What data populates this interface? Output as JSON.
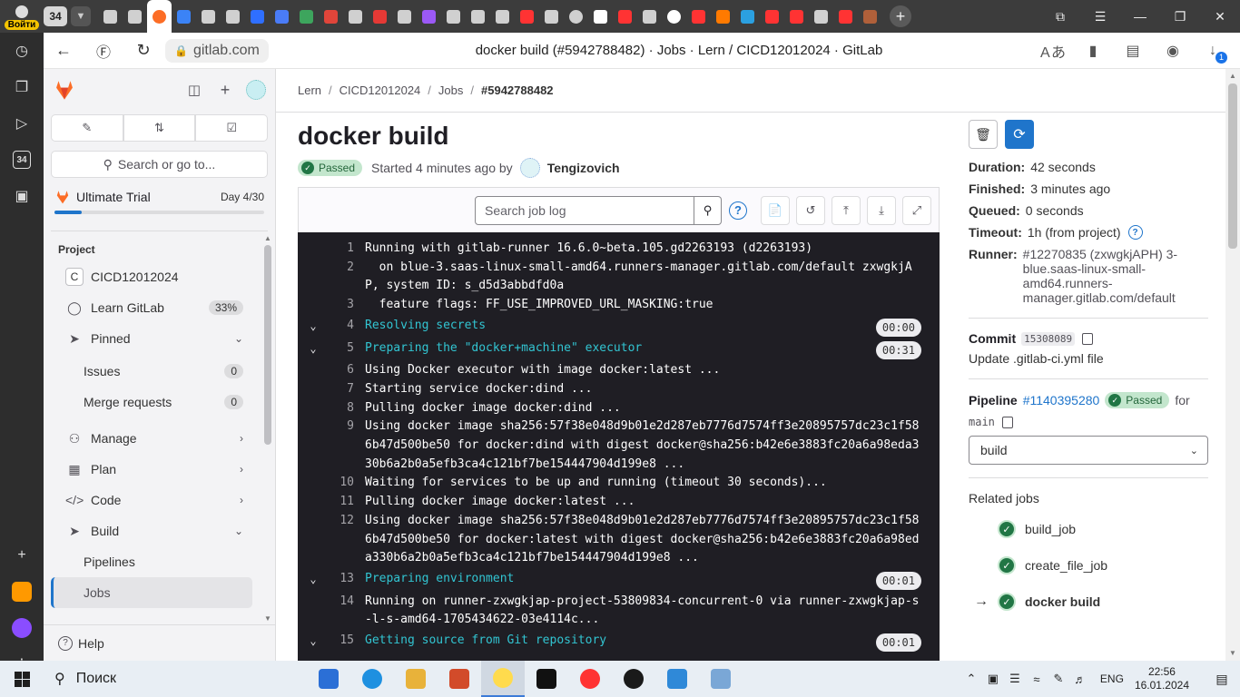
{
  "browser": {
    "login_label": "Войти",
    "tab_count": "34",
    "url": "gitlab.com",
    "page_title": "docker build (#5942788482) · Jobs · Lern / CICD12012024 · GitLab",
    "downloads_badge": "1",
    "sidebar_badge": "34",
    "tab_icon_colors": [
      "#d0d0d0",
      "#d0d0d0",
      "#fc6d26",
      "#3b83f6",
      "#d0d0d0",
      "#d0d0d0",
      "#2f6fff",
      "#4a7cf7",
      "#3da55d",
      "#e0453a",
      "#d0d0d0",
      "#e53935",
      "#d0d0d0",
      "#9b59f6",
      "#d0d0d0",
      "#d0d0d0",
      "#d0d0d0",
      "#f33",
      "#d0d0d0",
      "#d0d0d0",
      "#ffffff",
      "#f33",
      "#d0d0d0",
      "#ffffff",
      "#f33",
      "#ff7a00",
      "#2ba0e0",
      "#f33",
      "#f33",
      "#d0d0d0",
      "#f33",
      "#b0603a"
    ]
  },
  "gitlab_sidebar": {
    "search_label": "Search or go to...",
    "trial": {
      "name": "Ultimate Trial",
      "day": "Day 4/30",
      "progress": 0.13
    },
    "section_title": "Project",
    "items": [
      {
        "label": "CICD12012024",
        "icon": "project-avatar",
        "initial": "C"
      },
      {
        "label": "Learn GitLab",
        "icon": "bulb-icon",
        "count": "33%"
      },
      {
        "label": "Pinned",
        "icon": "pin-icon",
        "chevron": "down"
      },
      {
        "label": "Issues",
        "count": "0",
        "sub": true
      },
      {
        "label": "Merge requests",
        "count": "0",
        "sub": true
      },
      {
        "label": "Manage",
        "icon": "users-icon",
        "chevron": "right"
      },
      {
        "label": "Plan",
        "icon": "calendar-icon",
        "chevron": "right"
      },
      {
        "label": "Code",
        "icon": "code-icon",
        "chevron": "right"
      },
      {
        "label": "Build",
        "icon": "rocket-icon",
        "chevron": "down"
      },
      {
        "label": "Pipelines",
        "sub": true
      },
      {
        "label": "Jobs",
        "sub": true,
        "active": true
      }
    ],
    "help_label": "Help"
  },
  "breadcrumbs": [
    "Lern",
    "CICD12012024",
    "Jobs",
    "#5942788482"
  ],
  "job": {
    "title": "docker build",
    "status": "Passed",
    "started": "Started 4 minutes ago by",
    "author": "Tengizovich"
  },
  "log_toolbar": {
    "search_placeholder": "Search job log"
  },
  "log_lines": [
    {
      "n": "1",
      "text": "Running with gitlab-runner 16.6.0~beta.105.gd2263193 (d2263193)"
    },
    {
      "n": "2",
      "text": "  on blue-3.saas-linux-small-amd64.runners-manager.gitlab.com/default zxwgkjAP, system ID: s_d5d3abbdfd0a"
    },
    {
      "n": "3",
      "text": "  feature flags: FF_USE_IMPROVED_URL_MASKING:true"
    },
    {
      "n": "4",
      "text": "Resolving secrets",
      "section": true,
      "dur": "00:00"
    },
    {
      "n": "5",
      "text": "Preparing the \"docker+machine\" executor",
      "section": true,
      "dur": "00:31"
    },
    {
      "n": "6",
      "text": "Using Docker executor with image docker:latest ..."
    },
    {
      "n": "7",
      "text": "Starting service docker:dind ..."
    },
    {
      "n": "8",
      "text": "Pulling docker image docker:dind ..."
    },
    {
      "n": "9",
      "text": "Using docker image sha256:57f38e048d9b01e2d287eb7776d7574ff3e20895757dc23c1f586b47d500be50 for docker:dind with digest docker@sha256:b42e6e3883fc20a6a98eda330b6a2b0a5efb3ca4c121bf7be154447904d199e8 ..."
    },
    {
      "n": "10",
      "text": "Waiting for services to be up and running (timeout 30 seconds)..."
    },
    {
      "n": "11",
      "text": "Pulling docker image docker:latest ..."
    },
    {
      "n": "12",
      "text": "Using docker image sha256:57f38e048d9b01e2d287eb7776d7574ff3e20895757dc23c1f586b47d500be50 for docker:latest with digest docker@sha256:b42e6e3883fc20a6a98eda330b6a2b0a5efb3ca4c121bf7be154447904d199e8 ..."
    },
    {
      "n": "13",
      "text": "Preparing environment",
      "section": true,
      "dur": "00:01"
    },
    {
      "n": "14",
      "text": "Running on runner-zxwgkjap-project-53809834-concurrent-0 via runner-zxwgkjap-s-l-s-amd64-1705434622-03e4114c..."
    },
    {
      "n": "15",
      "text": "Getting source from Git repository",
      "section": true,
      "dur": "00:01"
    }
  ],
  "details": {
    "duration_label": "Duration:",
    "duration": "42 seconds",
    "finished_label": "Finished:",
    "finished": "3 minutes ago",
    "queued_label": "Queued:",
    "queued": "0 seconds",
    "timeout_label": "Timeout:",
    "timeout": "1h (from project)",
    "runner_label": "Runner:",
    "runner": "#12270835 (zxwgkjAPH) 3-blue.saas-linux-small-amd64.runners-manager.gitlab.com/default",
    "commit_label": "Commit",
    "commit_sha": "15308089",
    "commit_msg": "Update .gitlab-ci.yml file",
    "pipeline_label": "Pipeline",
    "pipeline_id": "#1140395280",
    "pipeline_status": "Passed",
    "pipeline_for": "for",
    "branch": "main",
    "stage": "build",
    "related_title": "Related jobs",
    "related_jobs": [
      {
        "name": "build_job",
        "current": false
      },
      {
        "name": "create_file_job",
        "current": false
      },
      {
        "name": "docker build",
        "current": true
      }
    ]
  },
  "taskbar": {
    "search_label": "Поиск",
    "lang": "ENG",
    "time": "22:56",
    "date": "16.01.2024",
    "app_colors": [
      "#2b6fd6",
      "#1e90e0",
      "#e8b23a",
      "#d24b2a",
      "#ffdb4d",
      "#111111",
      "#f33",
      "#1a1a1a",
      "#2f89d8",
      "#7aa7d6"
    ]
  }
}
